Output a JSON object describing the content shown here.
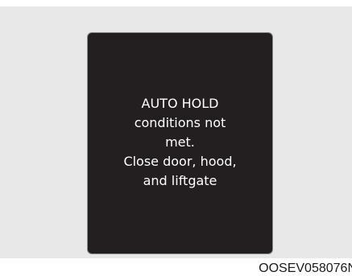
{
  "display": {
    "message_lines": [
      "AUTO HOLD",
      "conditions not",
      "met.",
      "Close door, hood,",
      "and liftgate"
    ]
  },
  "figure_code": "OOSEV058076N",
  "colors": {
    "backdrop": "#e8e8e8",
    "panel": "#231f20",
    "panel_border": "#8a8a8a",
    "message_text": "#ffffff",
    "code_text": "#1a1a1a"
  }
}
